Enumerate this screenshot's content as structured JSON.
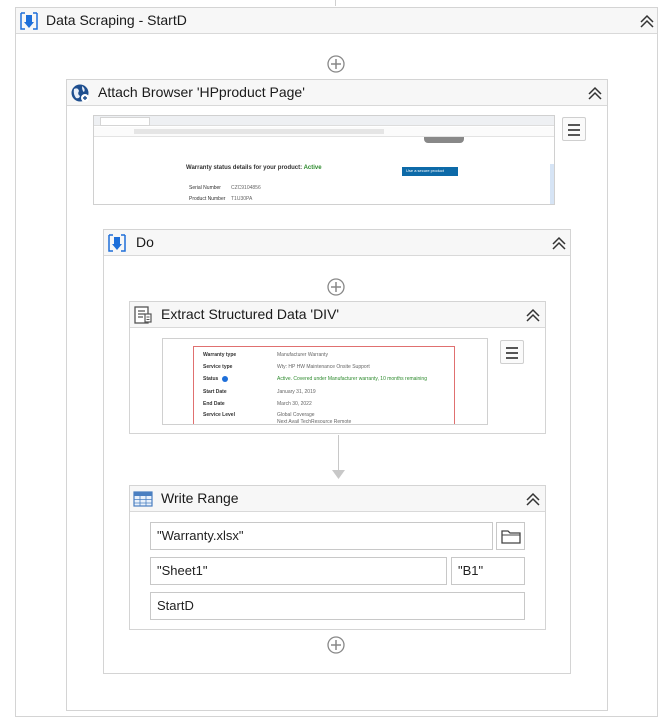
{
  "outer": {
    "title": "Data Scraping - StartD"
  },
  "attach": {
    "title": "Attach Browser 'HPproduct Page'",
    "preview": {
      "heading": "Warranty status details for your product:",
      "status": "Active",
      "button": "Use a secure product",
      "rows": [
        {
          "label": "Serial Number",
          "value": "CZC9104856"
        },
        {
          "label": "Product Number",
          "value": "T1U30PA"
        }
      ]
    }
  },
  "do": {
    "title": "Do"
  },
  "extract": {
    "title": "Extract Structured Data 'DIV'",
    "preview": {
      "rows": [
        {
          "label": "Warranty type",
          "value": "Manufacturer Warranty"
        },
        {
          "label": "Service type",
          "value": "Wty: HP HW Maintenance Onsite Support"
        },
        {
          "label": "Status",
          "value": "Active. Covered under Manufacturer warranty, 10 months remaining"
        },
        {
          "label": "Start Date",
          "value": "January 31, 2019"
        },
        {
          "label": "End Date",
          "value": "March 30, 2022"
        },
        {
          "label": "Service Level",
          "value": "Global Coverage"
        },
        {
          "label": "",
          "value": "Next Avail TechResource Remote"
        }
      ]
    }
  },
  "write": {
    "title": "Write Range",
    "workbook_path": "\"Warranty.xlsx\"",
    "sheet_name": "\"Sheet1\"",
    "starting_cell": "\"B1\"",
    "data_table": "StartD"
  },
  "colors": {
    "accent": "#1e6fd9",
    "border": "#d4d4d4",
    "header_bg": "#f7f7f7",
    "active_green": "#2e8b2e"
  }
}
